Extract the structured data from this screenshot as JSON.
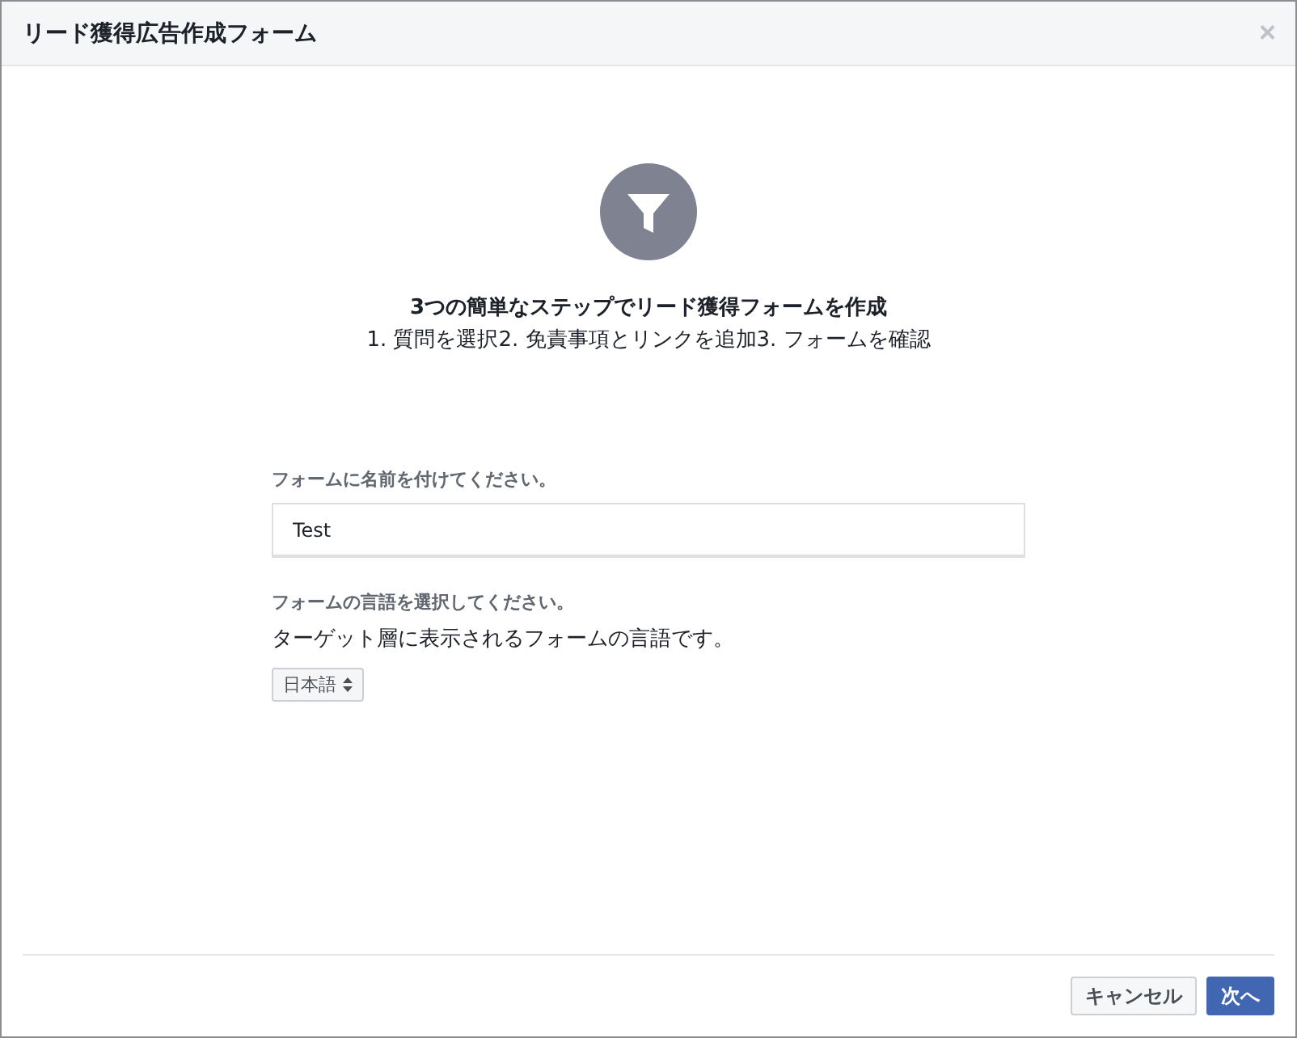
{
  "dialog": {
    "title": "リード獲得広告作成フォーム",
    "close": "×"
  },
  "intro": {
    "heading": "3つの簡単なステップでリード獲得フォームを作成",
    "steps": "1. 質問を選択2. 免責事項とリンクを追加3. フォームを確認"
  },
  "name_field": {
    "label": "フォームに名前を付けてください。",
    "value": "Test"
  },
  "language": {
    "label": "フォームの言語を選択してください。",
    "description": "ターゲット層に表示されるフォームの言語です。",
    "selected_option": "日本語"
  },
  "buttons": [
    {
      "label": "キャンセル",
      "kind": "secondary"
    },
    {
      "label": "次へ",
      "kind": "primary"
    }
  ]
}
